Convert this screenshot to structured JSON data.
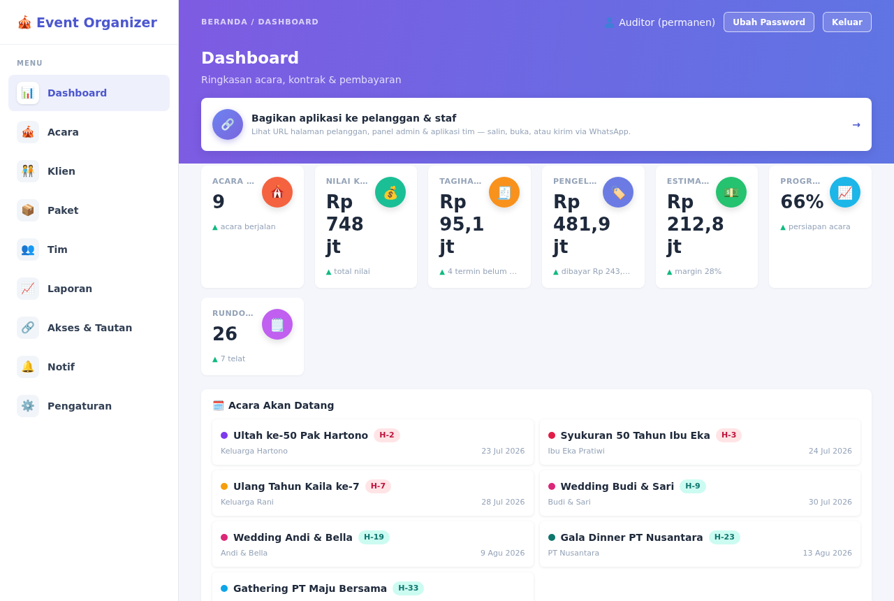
{
  "sidebar": {
    "brand": {
      "icon": "🎪",
      "name": "Event Organizer"
    },
    "section_label": "MENU",
    "items": [
      {
        "icon": "📊",
        "label": "Dashboard",
        "selected": true
      },
      {
        "icon": "🎪",
        "label": "Acara",
        "selected": false
      },
      {
        "icon": "🧑‍🤝‍🧑",
        "label": "Klien",
        "selected": false
      },
      {
        "icon": "📦",
        "label": "Paket",
        "selected": false
      },
      {
        "icon": "👥",
        "label": "Tim",
        "selected": false
      },
      {
        "icon": "📈",
        "label": "Laporan",
        "selected": false
      },
      {
        "icon": "🔗",
        "label": "Akses & Tautan",
        "selected": false
      },
      {
        "icon": "🔔",
        "label": "Notif",
        "selected": false
      },
      {
        "icon": "⚙️",
        "label": "Pengaturan",
        "selected": false
      }
    ]
  },
  "header": {
    "breadcrumb": "BERANDA / DASHBOARD",
    "user": {
      "name": "Auditor (permanen)"
    },
    "buttons": [
      "Ubah Password",
      "Keluar"
    ],
    "title": "Dashboard",
    "subtitle": "Ringkasan acara, kontrak & pembayaran"
  },
  "share_banner": {
    "title": "Bagikan aplikasi ke pelanggan & staf",
    "description": "Lihat URL halaman pelanggan, panel admin & aplikasi tim — salin, buka, atau kirim via WhatsApp.",
    "arrow": "→"
  },
  "stats": [
    {
      "label": "ACARA …",
      "value": "9",
      "color": "#f4623f",
      "marker": "▲",
      "note": "acara berjalan"
    },
    {
      "label": "NILAI K…",
      "value": "Rp 748 jt",
      "icon": "💰",
      "color": "#1bbf95",
      "marker": "▲",
      "note": "total nilai"
    },
    {
      "label": "TAGIHA…",
      "value": "Rp 95,1 jt",
      "icon": "🧾",
      "color": "#f8921c",
      "marker": "▲",
      "note": "4 termin belum …"
    },
    {
      "label": "PENGEL…",
      "value": "Rp 481,9 jt",
      "icon": "🏷️",
      "color": "#6b7be3",
      "marker": "▲",
      "note": "dibayar Rp 243,…"
    },
    {
      "label": "ESTIMA…",
      "value": "Rp 212,8 jt",
      "icon": "💵",
      "color": "#25c270",
      "marker": "▲",
      "note": "margin 28%"
    },
    {
      "label": "PROGR…",
      "value": "66%",
      "icon": "📈",
      "color": "#1cb6e8",
      "marker": "▲",
      "note": "persiapan acara"
    },
    {
      "label": "RUNDO…",
      "value": "26",
      "icon": "🗒️",
      "color": "#c05ff0",
      "marker": "▲",
      "note": "7 telat"
    }
  ],
  "upcoming_events": {
    "icon": "🗓️",
    "title": "Acara Akan Datang",
    "items": [
      {
        "title": "Ultah ke-50 Pak Hartono",
        "color": "#7c3aed",
        "countdown": "H-2",
        "urgent": true,
        "client": "Keluarga Hartono",
        "date": "23 Jul 2026"
      },
      {
        "title": "Syukuran 50 Tahun Ibu Eka",
        "color": "#e11d48",
        "countdown": "H-3",
        "urgent": true,
        "client": "Ibu Eka Pratiwi",
        "date": "24 Jul 2026"
      },
      {
        "title": "Ulang Tahun Kaila ke-7",
        "color": "#f59e0b",
        "countdown": "H-7",
        "urgent": true,
        "client": "Keluarga Rani",
        "date": "28 Jul 2026"
      },
      {
        "title": "Wedding Budi & Sari",
        "color": "#db2777",
        "countdown": "H-9",
        "urgent": false,
        "client": "Budi & Sari",
        "date": "30 Jul 2026"
      },
      {
        "title": "Wedding Andi & Bella",
        "color": "#db2777",
        "countdown": "H-19",
        "urgent": false,
        "client": "Andi & Bella",
        "date": "9 Agu 2026"
      },
      {
        "title": "Gala Dinner PT Nusantara",
        "color": "#0f766e",
        "countdown": "H-23",
        "urgent": false,
        "client": "PT Nusantara",
        "date": "13 Agu 2026"
      },
      {
        "title": "Gathering PT Maju Bersama",
        "color": "#0ea5e9",
        "countdown": "H-33",
        "urgent": false
      }
    ]
  }
}
